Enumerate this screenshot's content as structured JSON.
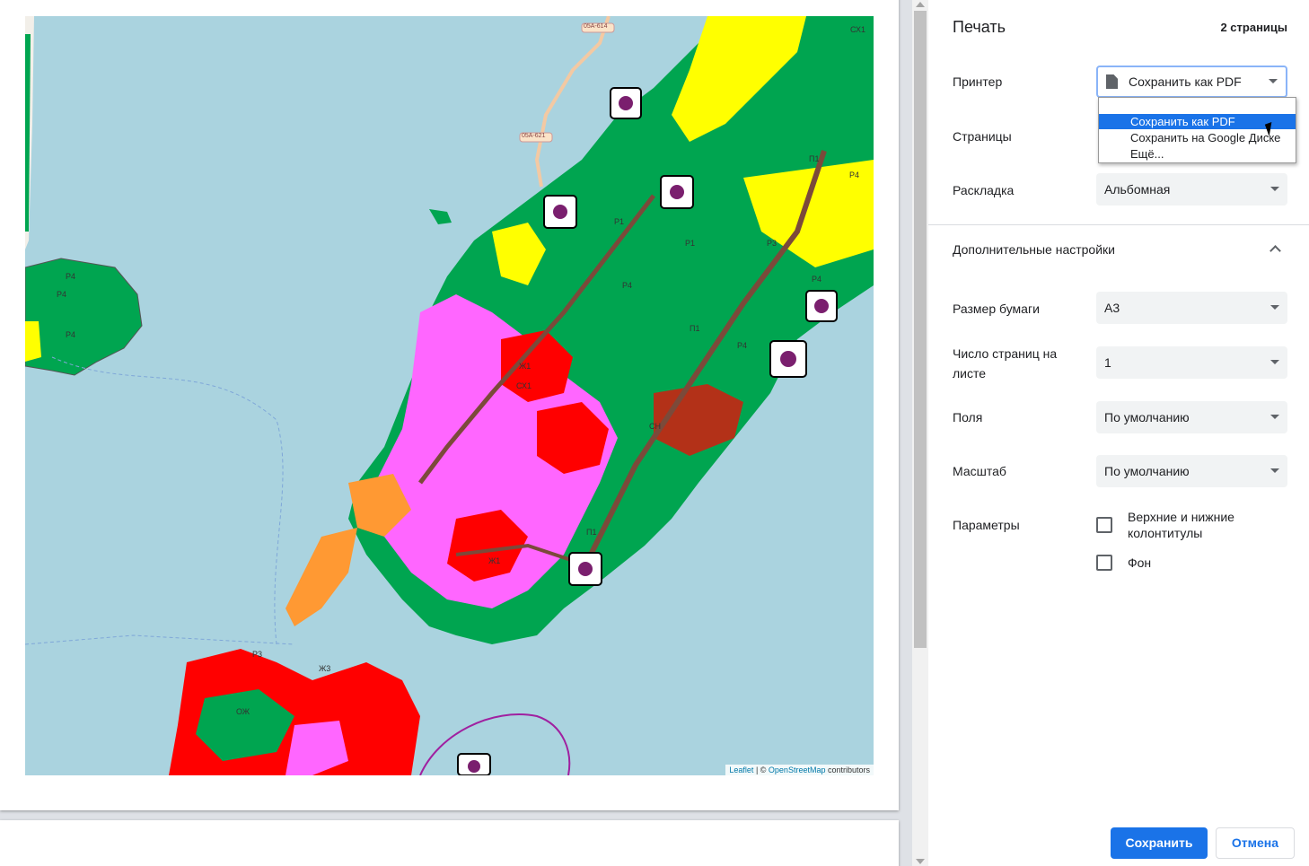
{
  "header": {
    "title": "Печать",
    "page_count": "2 страницы"
  },
  "printer": {
    "label": "Принтер",
    "selected": "Сохранить как PDF",
    "options": [
      "Сохранить как PDF",
      "Сохранить на Google Диске",
      "Ещё..."
    ]
  },
  "pages": {
    "label": "Страницы"
  },
  "layout": {
    "label": "Раскладка",
    "value": "Альбомная"
  },
  "more_settings": {
    "label": "Дополнительные настройки"
  },
  "paper_size": {
    "label": "Размер бумаги",
    "value": "A3"
  },
  "pages_per_sheet": {
    "label": "Число страниц на листе",
    "value": "1"
  },
  "margins": {
    "label": "Поля",
    "value": "По умолчанию"
  },
  "scale": {
    "label": "Масштаб",
    "value": "По умолчанию"
  },
  "options": {
    "label": "Параметры",
    "headers_footers": "Верхние и нижние колонтитулы",
    "background": "Фон"
  },
  "buttons": {
    "save": "Сохранить",
    "cancel": "Отмена"
  },
  "map": {
    "attribution_leaflet": "Leaflet",
    "attribution_sep": " | © ",
    "attribution_osm": "OpenStreetMap",
    "attribution_rest": " contributors",
    "road_labels": [
      "05A-614",
      "05A-621"
    ],
    "zone_labels": [
      "Р4",
      "Р4",
      "Р4",
      "Р4",
      "Р4",
      "Р4",
      "Р4",
      "Р1",
      "Р1",
      "Р3",
      "Р3",
      "П1",
      "П1",
      "П1",
      "Ж1",
      "Ж1",
      "Ж3",
      "ОЖ",
      "СХ1",
      "СХ1",
      "СН"
    ],
    "colors": {
      "water": "#aad3df",
      "land": "#f2efe9",
      "green": "#00a550",
      "yellow": "#ffff00",
      "pink": "#ff66ff",
      "red": "#ff0000",
      "brown": "#7b4a3a",
      "orange": "#ff9933"
    }
  }
}
